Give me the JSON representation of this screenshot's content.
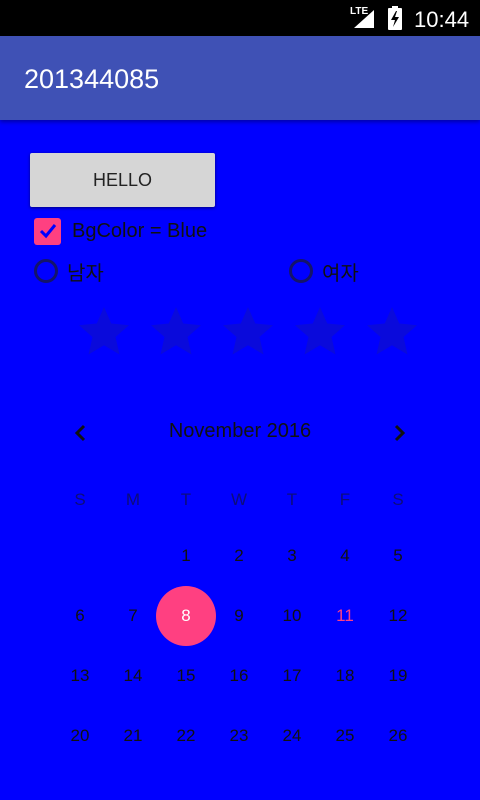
{
  "status_bar": {
    "network_label": "LTE",
    "signal_icon": "signal-icon",
    "battery_icon": "battery-charging-icon",
    "time": "10:44"
  },
  "app_bar": {
    "title": "201344085",
    "color": "#3f51b5"
  },
  "background_color": "#0000ff",
  "accent_color": "#ff4081",
  "hello_button": {
    "label": "HELLO"
  },
  "checkbox": {
    "label": "BgColor = Blue",
    "checked": true
  },
  "radios": [
    {
      "label": "남자",
      "selected": false
    },
    {
      "label": "여자",
      "selected": false
    }
  ],
  "rating": {
    "stars": 5,
    "value": 0
  },
  "calendar": {
    "title": "November 2016",
    "prev_icon": "chevron-left-icon",
    "next_icon": "chevron-right-icon",
    "weekdays": [
      "S",
      "M",
      "T",
      "W",
      "T",
      "F",
      "S"
    ],
    "weeks": [
      [
        "",
        "",
        "1",
        "2",
        "3",
        "4",
        "5"
      ],
      [
        "6",
        "7",
        "8",
        "9",
        "10",
        "11",
        "12"
      ],
      [
        "13",
        "14",
        "15",
        "16",
        "17",
        "18",
        "19"
      ],
      [
        "20",
        "21",
        "22",
        "23",
        "24",
        "25",
        "26"
      ]
    ],
    "selected_day": "8",
    "today": "11"
  }
}
